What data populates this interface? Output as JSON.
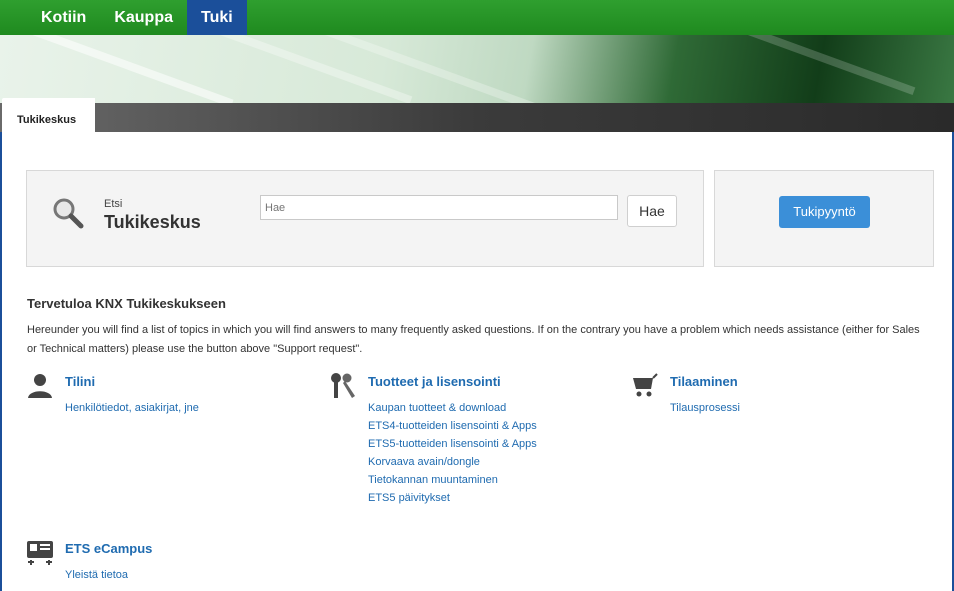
{
  "nav": {
    "items": [
      {
        "label": "Kotiin"
      },
      {
        "label": "Kauppa"
      },
      {
        "label": "Tuki"
      }
    ],
    "active": "Tuki"
  },
  "tab": {
    "label": "Tukikeskus"
  },
  "search": {
    "small_label": "Etsi",
    "title": "Tukikeskus",
    "placeholder": "Hae",
    "button_label": "Hae"
  },
  "support": {
    "button_label": "Tukipyyntö"
  },
  "welcome": {
    "title": "Tervetuloa KNX Tukikeskukseen",
    "text": "Hereunder you will find a list of topics in which you will find answers to many frequently asked questions. If on the contrary you have a problem which needs assistance (either for Sales or Technical matters) please use the button above \"Support request\"."
  },
  "categories": [
    {
      "icon": "user-icon",
      "title": "Tilini",
      "links": [
        "Henkilötiedot, asiakirjat, jne"
      ]
    },
    {
      "icon": "keys-icon",
      "title": "Tuotteet ja lisensointi",
      "links": [
        "Kaupan tuotteet & download",
        "ETS4-tuotteiden lisensointi & Apps",
        "ETS5-tuotteiden lisensointi & Apps",
        "Korvaava avain/dongle",
        "Tietokannan muuntaminen",
        "ETS5 päivitykset"
      ]
    },
    {
      "icon": "cart-icon",
      "title": "Tilaaminen",
      "links": [
        "Tilausprosessi"
      ]
    },
    {
      "icon": "ecampus-icon",
      "title": "ETS eCampus",
      "links": [
        "Yleistä tietoa"
      ]
    }
  ],
  "colors": {
    "nav_green": "#239323",
    "active_blue": "#1b4f9a",
    "link_blue": "#1f6bb0",
    "button_blue": "#3b8fd8"
  }
}
